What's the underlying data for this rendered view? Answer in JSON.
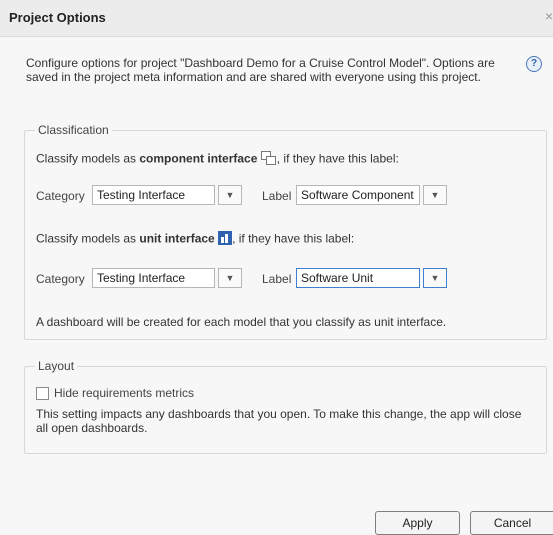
{
  "window": {
    "title": "Project Options",
    "close_glyph": "×"
  },
  "intro": "Configure options for project \"Dashboard Demo for a Cruise Control Model\". Options are saved in the project meta information and are shared with everyone using this project.",
  "help_glyph": "?",
  "classification": {
    "title": "Classification",
    "component": {
      "prefix": "Classify models as ",
      "bold": "component interface",
      "suffix": ", if they have this label:",
      "icon": "component-interface-icon",
      "category_label": "Category",
      "category_value": "Testing Interface",
      "label_label": "Label",
      "label_value": "Software Component"
    },
    "unit": {
      "prefix": "Classify models as ",
      "bold": "unit interface",
      "suffix": ", if they have this label:",
      "icon": "unit-interface-icon",
      "category_label": "Category",
      "category_value": "Testing Interface",
      "label_label": "Label",
      "label_value": "Software Unit"
    },
    "note": "A dashboard will be created for each model that you classify as unit interface."
  },
  "layout": {
    "title": "Layout",
    "hide_req_label": "Hide requirements metrics",
    "hide_req_checked": false,
    "note": "This setting impacts any dashboards that you open. To make this change, the app will close all open dashboards."
  },
  "buttons": {
    "apply": "Apply",
    "cancel": "Cancel"
  },
  "colors": {
    "focus": "#3f7fd0",
    "help": "#2d5ea8",
    "unit_icon": "#2f63b0"
  }
}
